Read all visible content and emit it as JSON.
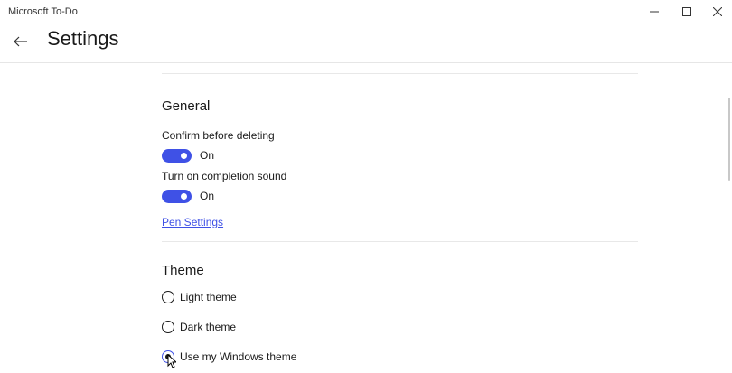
{
  "window": {
    "app_title": "Microsoft To-Do"
  },
  "header": {
    "title": "Settings"
  },
  "general": {
    "heading": "General",
    "confirm_label": "Confirm before deleting",
    "confirm_state": "On",
    "sound_label": "Turn on completion sound",
    "sound_state": "On",
    "pen_link": "Pen Settings"
  },
  "theme": {
    "heading": "Theme",
    "options": [
      {
        "label": "Light theme",
        "selected": false
      },
      {
        "label": "Dark theme",
        "selected": false
      },
      {
        "label": "Use my Windows theme",
        "selected": true
      }
    ]
  },
  "colors": {
    "accent": "#3f51e6"
  }
}
